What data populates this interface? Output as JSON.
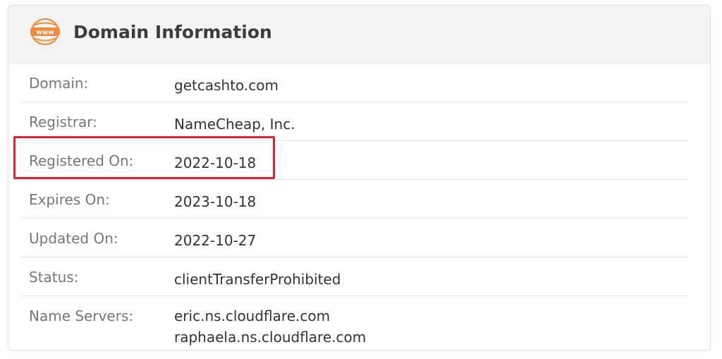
{
  "header": {
    "icon": "www-globe-icon",
    "icon_text": "www",
    "icon_color": "#f08a3c",
    "title": "Domain Information"
  },
  "rows": [
    {
      "label": "Domain:",
      "values": [
        "getcashto.com"
      ]
    },
    {
      "label": "Registrar:",
      "values": [
        "NameCheap, Inc."
      ]
    },
    {
      "label": "Registered On:",
      "values": [
        "2022-10-18"
      ],
      "highlighted": true
    },
    {
      "label": "Expires On:",
      "values": [
        "2023-10-18"
      ]
    },
    {
      "label": "Updated On:",
      "values": [
        "2022-10-27"
      ]
    },
    {
      "label": "Status:",
      "values": [
        "clientTransferProhibited"
      ]
    },
    {
      "label": "Name Servers:",
      "values": [
        "eric.ns.cloudflare.com",
        "raphaela.ns.cloudflare.com"
      ]
    }
  ],
  "highlight_color": "#d8262c"
}
